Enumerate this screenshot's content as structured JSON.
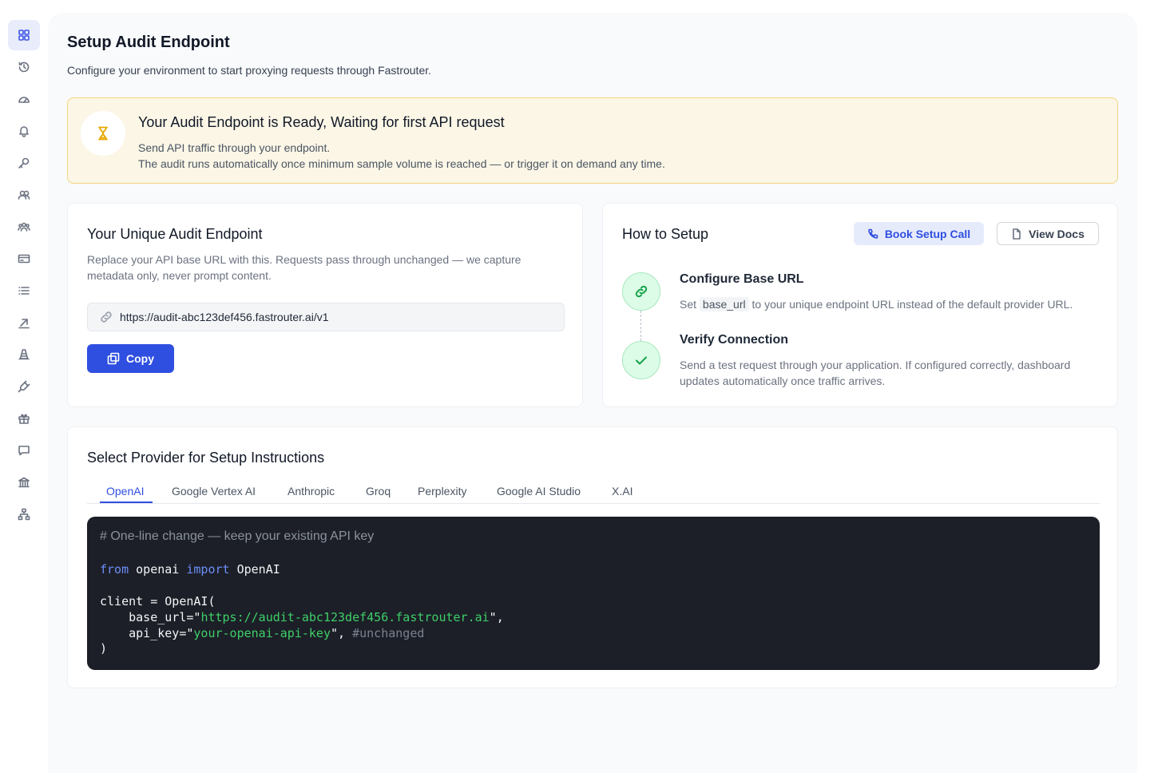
{
  "sidebar": {
    "items": [
      {
        "icon": "dashboard-icon",
        "active": true
      },
      {
        "icon": "history-icon",
        "active": false
      },
      {
        "icon": "gauge-icon",
        "active": false
      },
      {
        "icon": "bell-icon",
        "active": false
      },
      {
        "icon": "key-icon",
        "active": false
      },
      {
        "icon": "users-icon",
        "active": false
      },
      {
        "icon": "team-icon",
        "active": false
      },
      {
        "icon": "credit-card-icon",
        "active": false
      },
      {
        "icon": "list-icon",
        "active": false
      },
      {
        "icon": "arrow-up-right-icon",
        "active": false
      },
      {
        "icon": "cone-icon",
        "active": false
      },
      {
        "icon": "plug-icon",
        "active": false
      },
      {
        "icon": "gift-icon",
        "active": false
      },
      {
        "icon": "chat-icon",
        "active": false
      },
      {
        "icon": "bank-icon",
        "active": false
      },
      {
        "icon": "network-icon",
        "active": false
      }
    ]
  },
  "page": {
    "title": "Setup Audit Endpoint",
    "subtitle": "Configure your environment to start proxying requests through Fastrouter."
  },
  "banner": {
    "icon": "hourglass-icon",
    "title": "Your Audit Endpoint is Ready, Waiting for first API request",
    "line1": "Send API traffic through your endpoint.",
    "line2": "The audit runs automatically once minimum sample volume is reached — or trigger it on demand any time."
  },
  "endpoint_card": {
    "title": "Your Unique Audit Endpoint",
    "description": "Replace your API base URL with this. Requests pass through unchanged — we capture metadata only, never prompt content.",
    "url": "https://audit-abc123def456.fastrouter.ai/v1",
    "copy_label": "Copy"
  },
  "setup_card": {
    "title": "How to Setup",
    "book_label": "Book Setup Call",
    "docs_label": "View Docs",
    "steps": [
      {
        "title": "Configure Base URL",
        "desc_before": "Set",
        "desc_code": "base_url",
        "desc_after": "to your unique endpoint URL instead of the default provider URL."
      },
      {
        "title": "Verify Connection",
        "desc": "Send  a test request through your application. If configured correctly, dashboard updates automatically once traffic arrives."
      }
    ]
  },
  "provider_card": {
    "title": "Select Provider for Setup Instructions",
    "tabs": [
      "OpenAI",
      "Google Vertex AI",
      "Anthropic",
      "Groq",
      "Perplexity",
      "Google AI Studio",
      "X.AI"
    ],
    "active_tab": "OpenAI",
    "code": {
      "comment": "# One-line change — keep your existing API key",
      "kw_from": "from",
      "module": "openai",
      "kw_import": "import",
      "class_name": "OpenAI",
      "client_line": "client = OpenAI(",
      "base_url_key": "    base_url=\"",
      "base_url_value": "https://audit-abc123def456.fastrouter.ai",
      "base_url_end": "\",",
      "api_key_key": "    api_key=\"",
      "api_key_value": "your-openai-api-key",
      "api_key_end": "\", ",
      "api_key_comment": "#unchanged",
      "close": ")"
    }
  },
  "colors": {
    "accent": "#2f4fe0",
    "banner_bg": "#fbf6e6",
    "banner_border": "#f3d47c",
    "success": "#16a34a",
    "code_bg": "#1c1f27"
  }
}
